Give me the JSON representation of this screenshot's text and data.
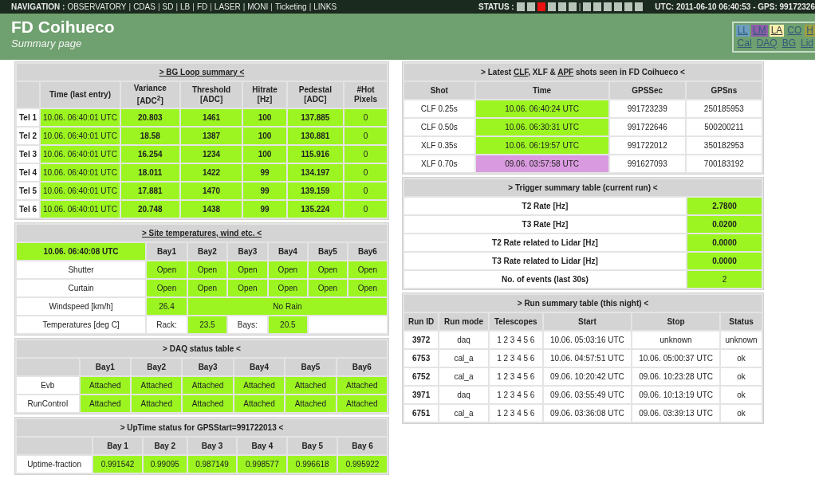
{
  "nav": {
    "label": "NAVIGATION :",
    "separator": "|",
    "links": [
      "OBSERVATORY",
      "CDAS",
      "SD",
      "LB",
      "FD",
      "LASER",
      "MONI",
      "Ticketing",
      "LINKS"
    ]
  },
  "status": {
    "label": "STATUS :",
    "separator": "|",
    "groups": [
      [
        {
          "color": "#b9c4b9"
        },
        {
          "color": "#b9c4b9"
        },
        {
          "color": "#ee1111"
        },
        {
          "color": "#b9c4b9"
        },
        {
          "color": "#b9c4b9"
        },
        {
          "color": "#b9c4b9"
        }
      ],
      [
        {
          "color": "#b9c4b9"
        },
        {
          "color": "#b9c4b9"
        },
        {
          "color": "#b9c4b9"
        },
        {
          "color": "#b9c4b9"
        },
        {
          "color": "#b9c4b9"
        },
        {
          "color": "#b9c4b9"
        }
      ]
    ]
  },
  "clock": "UTC: 2011-06-10 06:40:53 - GPS: 99172326",
  "header": {
    "title": "FD Coihueco",
    "subtitle": "Summary page"
  },
  "sites": [
    [
      {
        "label": "LL",
        "color": "#6f9fc0",
        "selected": false
      },
      {
        "label": "LM",
        "color": "#8e5fa8",
        "selected": false
      },
      {
        "label": "LA",
        "color": "#fff0b0",
        "selected": true
      },
      {
        "label": "CO",
        "color": "#6fa06f",
        "selected": false
      },
      {
        "label": "H",
        "color": "#a0a040",
        "selected": false
      }
    ],
    [
      {
        "label": "Cal",
        "color": "#6fa06f",
        "selected": false
      },
      {
        "label": "DAQ",
        "color": "#6fa06f",
        "selected": false
      },
      {
        "label": "BG",
        "color": "#6fa06f",
        "selected": false
      },
      {
        "label": "Lid",
        "color": "#6fa06f",
        "selected": false
      }
    ]
  ],
  "left_tables": [
    {
      "title": [
        {
          "text": "> BG Loop summary <",
          "link": true
        }
      ],
      "rows": [
        {
          "kind": "head",
          "cells": [
            null,
            "Time (last entry)",
            "Variance [ADC$^{2}$]",
            "Threshold [ADC]",
            "Hitrate [Hz]",
            "Pedestal [ADC]",
            "#Hot Pixels"
          ]
        },
        {
          "kind": "data",
          "cells": [
            {
              "t": "Tel 1",
              "bold": true
            },
            {
              "t": "10.06. 06:40:01 UTC",
              "color": "#9cf521"
            },
            {
              "t": "20.803",
              "color": "#9cf521",
              "bold": true
            },
            {
              "t": "1461",
              "color": "#9cf521",
              "bold": true
            },
            {
              "t": "100",
              "color": "#9cf521",
              "bold": true
            },
            {
              "t": "137.885",
              "color": "#9cf521",
              "bold": true
            },
            {
              "t": "0",
              "color": "#9cf521"
            }
          ]
        },
        {
          "kind": "data",
          "cells": [
            {
              "t": "Tel 2",
              "bold": true
            },
            {
              "t": "10.06. 06:40:01 UTC",
              "color": "#9cf521"
            },
            {
              "t": "18.58",
              "color": "#9cf521",
              "bold": true
            },
            {
              "t": "1387",
              "color": "#9cf521",
              "bold": true
            },
            {
              "t": "100",
              "color": "#9cf521",
              "bold": true
            },
            {
              "t": "130.881",
              "color": "#9cf521",
              "bold": true
            },
            {
              "t": "0",
              "color": "#9cf521"
            }
          ]
        },
        {
          "kind": "data",
          "cells": [
            {
              "t": "Tel 3",
              "bold": true
            },
            {
              "t": "10.06. 06:40:01 UTC",
              "color": "#9cf521"
            },
            {
              "t": "16.254",
              "color": "#9cf521",
              "bold": true
            },
            {
              "t": "1234",
              "color": "#9cf521",
              "bold": true
            },
            {
              "t": "100",
              "color": "#9cf521",
              "bold": true
            },
            {
              "t": "115.916",
              "color": "#9cf521",
              "bold": true
            },
            {
              "t": "0",
              "color": "#9cf521"
            }
          ]
        },
        {
          "kind": "data",
          "cells": [
            {
              "t": "Tel 4",
              "bold": true
            },
            {
              "t": "10.06. 06:40:01 UTC",
              "color": "#9cf521"
            },
            {
              "t": "18.011",
              "color": "#9cf521",
              "bold": true
            },
            {
              "t": "1422",
              "color": "#9cf521",
              "bold": true
            },
            {
              "t": "99",
              "color": "#9cf521",
              "bold": true
            },
            {
              "t": "134.197",
              "color": "#9cf521",
              "bold": true
            },
            {
              "t": "0",
              "color": "#9cf521"
            }
          ]
        },
        {
          "kind": "data",
          "cells": [
            {
              "t": "Tel 5",
              "bold": true
            },
            {
              "t": "10.06. 06:40:01 UTC",
              "color": "#9cf521"
            },
            {
              "t": "17.881",
              "color": "#9cf521",
              "bold": true
            },
            {
              "t": "1470",
              "color": "#9cf521",
              "bold": true
            },
            {
              "t": "99",
              "color": "#9cf521",
              "bold": true
            },
            {
              "t": "139.159",
              "color": "#9cf521",
              "bold": true
            },
            {
              "t": "0",
              "color": "#9cf521"
            }
          ]
        },
        {
          "kind": "data",
          "cells": [
            {
              "t": "Tel 6",
              "bold": true
            },
            {
              "t": "10.06. 06:40:01 UTC",
              "color": "#9cf521"
            },
            {
              "t": "20.748",
              "color": "#9cf521",
              "bold": true
            },
            {
              "t": "1438",
              "color": "#9cf521",
              "bold": true
            },
            {
              "t": "99",
              "color": "#9cf521",
              "bold": true
            },
            {
              "t": "135.224",
              "color": "#9cf521",
              "bold": true
            },
            {
              "t": "0",
              "color": "#9cf521"
            }
          ]
        }
      ]
    },
    {
      "title": [
        {
          "text": "> Site temperatures, wind etc. <",
          "link": true
        }
      ],
      "rows": [
        {
          "kind": "head",
          "cells": [
            {
              "t": "10.06. 06:40:08 UTC",
              "color": "#9cf521",
              "bold": true
            },
            "Bay1",
            "Bay2",
            "Bay3",
            "Bay4",
            "Bay5",
            "Bay6"
          ]
        },
        {
          "kind": "data",
          "cells": [
            "Shutter",
            {
              "t": "Open",
              "color": "#9cf521"
            },
            {
              "t": "Open",
              "color": "#9cf521"
            },
            {
              "t": "Open",
              "color": "#9cf521"
            },
            {
              "t": "Open",
              "color": "#9cf521"
            },
            {
              "t": "Open",
              "color": "#9cf521"
            },
            {
              "t": "Open",
              "color": "#9cf521"
            }
          ]
        },
        {
          "kind": "data",
          "cells": [
            "Curtain",
            {
              "t": "Open",
              "color": "#9cf521"
            },
            {
              "t": "Open",
              "color": "#9cf521"
            },
            {
              "t": "Open",
              "color": "#9cf521"
            },
            {
              "t": "Open",
              "color": "#9cf521"
            },
            {
              "t": "Open",
              "color": "#9cf521"
            },
            {
              "t": "Open",
              "color": "#9cf521"
            }
          ]
        },
        {
          "kind": "data",
          "cells": [
            "Windspeed [km/h]",
            {
              "t": "26.4",
              "color": "#9cf521"
            },
            {
              "t": "No Rain",
              "color": "#9cf521",
              "colspan": 5
            }
          ]
        },
        {
          "kind": "data",
          "cells": [
            "Temperatures [deg C]",
            "Rack:",
            {
              "t": "23.5",
              "color": "#9cf521"
            },
            "Bays:",
            {
              "t": "20.5",
              "color": "#9cf521"
            },
            {
              "colspan": 2
            }
          ]
        }
      ]
    },
    {
      "title": [
        {
          "text": "> DAQ status table <",
          "link": false
        }
      ],
      "rows": [
        {
          "kind": "head",
          "cells": [
            null,
            "Bay1",
            "Bay2",
            "Bay3",
            "Bay4",
            "Bay5",
            "Bay6"
          ]
        },
        {
          "kind": "data",
          "cells": [
            "Evb",
            {
              "t": "Attached",
              "color": "#9cf521"
            },
            {
              "t": "Attached",
              "color": "#9cf521"
            },
            {
              "t": "Attached",
              "color": "#9cf521"
            },
            {
              "t": "Attached",
              "color": "#9cf521"
            },
            {
              "t": "Attached",
              "color": "#9cf521"
            },
            {
              "t": "Attached",
              "color": "#9cf521"
            }
          ]
        },
        {
          "kind": "data",
          "cells": [
            "RunControl",
            {
              "t": "Attached",
              "color": "#9cf521"
            },
            {
              "t": "Attached",
              "color": "#9cf521"
            },
            {
              "t": "Attached",
              "color": "#9cf521"
            },
            {
              "t": "Attached",
              "color": "#9cf521"
            },
            {
              "t": "Attached",
              "color": "#9cf521"
            },
            {
              "t": "Attached",
              "color": "#9cf521"
            }
          ]
        }
      ]
    },
    {
      "title": [
        {
          "text": "> UpTime status for GPSStart=991722013 <",
          "link": false
        }
      ],
      "rows": [
        {
          "kind": "head",
          "cells": [
            null,
            "Bay 1",
            "Bay 2",
            "Bay 3",
            "Bay 4",
            "Bay 5",
            "Bay 6"
          ]
        },
        {
          "kind": "data",
          "cells": [
            "Uptime-fraction",
            {
              "t": "0.991542",
              "color": "#9cf521"
            },
            {
              "t": "0.99095",
              "color": "#9cf521"
            },
            {
              "t": "0.987149",
              "color": "#9cf521"
            },
            {
              "t": "0.998577",
              "color": "#9cf521"
            },
            {
              "t": "0.996618",
              "color": "#9cf521"
            },
            {
              "t": "0.995922",
              "color": "#9cf521"
            }
          ]
        }
      ]
    }
  ],
  "right_tables": [
    {
      "title": [
        {
          "text": "> Latest ",
          "link": false
        },
        {
          "text": "CLF",
          "link": true
        },
        {
          "text": ", XLF & ",
          "link": false
        },
        {
          "text": "APF",
          "link": true
        },
        {
          "text": " shots seen in FD Coihueco <",
          "link": false
        }
      ],
      "rows": [
        {
          "kind": "head",
          "cells": [
            "Shot",
            "Time",
            "GPSSec",
            "GPSns"
          ]
        },
        {
          "kind": "data",
          "cells": [
            "CLF 0.25s",
            {
              "t": "10.06. 06:40:24 UTC",
              "color": "#9cf521"
            },
            "991723239",
            "250185953"
          ]
        },
        {
          "kind": "data",
          "cells": [
            "CLF 0.50s",
            {
              "t": "10.06. 06:30:31 UTC",
              "color": "#9cf521"
            },
            "991722646",
            "500200211"
          ]
        },
        {
          "kind": "data",
          "cells": [
            "XLF 0.35s",
            {
              "t": "10.06. 06:19:57 UTC",
              "color": "#9cf521"
            },
            "991722012",
            "350182953"
          ]
        },
        {
          "kind": "data",
          "cells": [
            "XLF 0.70s",
            {
              "t": "09.06. 03:57:58 UTC",
              "color": "#d99adf"
            },
            "991627093",
            "700183192"
          ]
        }
      ]
    },
    {
      "title": [
        {
          "text": "> Trigger summary table (current run) <",
          "link": false
        }
      ],
      "rows": [
        {
          "kind": "data",
          "cells": [
            {
              "t": "T2 Rate [Hz]",
              "bold": true
            },
            {
              "t": "2.7800",
              "color": "#9cf521",
              "bold": true
            }
          ]
        },
        {
          "kind": "data",
          "cells": [
            {
              "t": "T3 Rate [Hz]",
              "bold": true
            },
            {
              "t": "0.0200",
              "color": "#9cf521",
              "bold": true
            }
          ]
        },
        {
          "kind": "data",
          "cells": [
            {
              "t": "T2 Rate related to Lidar [Hz]",
              "bold": true
            },
            {
              "t": "0.0000",
              "color": "#9cf521",
              "bold": true
            }
          ]
        },
        {
          "kind": "data",
          "cells": [
            {
              "t": "T3 Rate related to Lidar [Hz]",
              "bold": true
            },
            {
              "t": "0.0000",
              "color": "#9cf521",
              "bold": true
            }
          ]
        },
        {
          "kind": "data",
          "cells": [
            {
              "t": "No. of events (last 30s)",
              "bold": true
            },
            {
              "t": "2",
              "color": "#9cf521"
            }
          ]
        }
      ]
    },
    {
      "title": [
        {
          "text": "> Run summary table (this night) <",
          "link": false
        }
      ],
      "rows": [
        {
          "kind": "head",
          "cells": [
            "Run ID",
            "Run mode",
            "Telescopes",
            "Start",
            "Stop",
            "Status"
          ]
        },
        {
          "kind": "data",
          "cells": [
            {
              "t": "3972",
              "bold": true
            },
            "daq",
            "1 2 3 4 5 6",
            "10.06. 05:03:16 UTC",
            "unknown",
            "unknown"
          ]
        },
        {
          "kind": "data",
          "cells": [
            {
              "t": "6753",
              "bold": true
            },
            "cal_a",
            "1 2 3 4 5 6",
            "10.06. 04:57:51 UTC",
            "10.06. 05:00:37 UTC",
            "ok"
          ]
        },
        {
          "kind": "data",
          "cells": [
            {
              "t": "6752",
              "bold": true
            },
            "cal_a",
            "1 2 3 4 5 6",
            "09.06. 10:20:42 UTC",
            "09.06. 10:23:28 UTC",
            "ok"
          ]
        },
        {
          "kind": "data",
          "cells": [
            {
              "t": "3971",
              "bold": true
            },
            "daq",
            "1 2 3 4 5 6",
            "09.06. 03:55:49 UTC",
            "09.06. 10:13:19 UTC",
            "ok"
          ]
        },
        {
          "kind": "data",
          "cells": [
            {
              "t": "6751",
              "bold": true
            },
            "cal_a",
            "1 2 3 4 5 6",
            "09.06. 03:36:08 UTC",
            "09.06. 03:39:13 UTC",
            "ok"
          ]
        }
      ]
    }
  ]
}
